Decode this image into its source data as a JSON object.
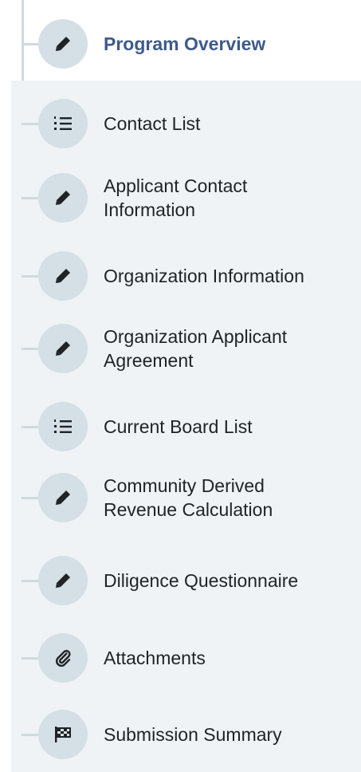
{
  "steps": [
    {
      "label": "Program Overview",
      "icon": "pencil-icon",
      "active": true
    },
    {
      "label": "Contact List",
      "icon": "list-icon",
      "active": false
    },
    {
      "label": "Applicant Contact\nInformation",
      "icon": "pencil-icon",
      "active": false
    },
    {
      "label": "Organization Information",
      "icon": "pencil-icon",
      "active": false
    },
    {
      "label": "Organization Applicant\nAgreement",
      "icon": "pencil-icon",
      "active": false
    },
    {
      "label": "Current Board List",
      "icon": "list-icon",
      "active": false
    },
    {
      "label": "Community Derived\nRevenue Calculation",
      "icon": "pencil-icon",
      "active": false
    },
    {
      "label": "Diligence Questionnaire",
      "icon": "pencil-icon",
      "active": false
    },
    {
      "label": "Attachments",
      "icon": "paperclip-icon",
      "active": false
    },
    {
      "label": "Submission Summary",
      "icon": "flag-checkered-icon",
      "active": false
    }
  ],
  "colors": {
    "active_text": "#3d5a8a",
    "text": "#1f2326",
    "rail": "#cfd9e0",
    "circle": "#d5dfe6",
    "panel": "#eff3f5"
  }
}
